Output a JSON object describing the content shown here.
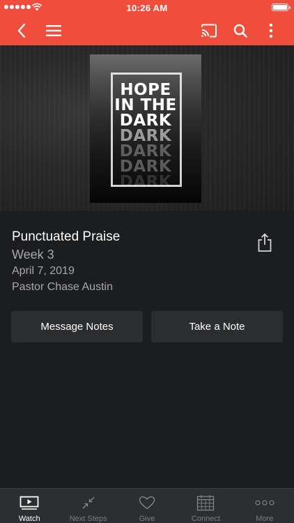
{
  "status_bar": {
    "time": "10:26 AM"
  },
  "nav": {
    "back_icon": "chevron-left-icon",
    "menu_icon": "hamburger-icon",
    "cast_icon": "cast-icon",
    "search_icon": "search-icon",
    "more_icon": "vertical-dots-icon"
  },
  "poster": {
    "line1": "HOPE",
    "line2": "IN THE",
    "line3": "DARK",
    "echo": [
      "DARK",
      "DARK",
      "DARK",
      "DARK"
    ]
  },
  "sermon": {
    "title": "Punctuated Praise",
    "week": "Week 3",
    "date": "April 7, 2019",
    "speaker": "Pastor Chase Austin"
  },
  "actions": {
    "message_notes": "Message Notes",
    "take_note": "Take a Note"
  },
  "tabs": [
    {
      "label": "Watch",
      "icon": "play-screen-icon",
      "active": true
    },
    {
      "label": "Next Steps",
      "icon": "arrows-in-icon",
      "active": false
    },
    {
      "label": "Give",
      "icon": "heart-icon",
      "active": false
    },
    {
      "label": "Connect",
      "icon": "calendar-icon",
      "active": false
    },
    {
      "label": "More",
      "icon": "horizontal-dots-icon",
      "active": false
    }
  ],
  "colors": {
    "accent": "#f04d3c",
    "background": "#1c1d1f",
    "button": "#2c2d2f"
  }
}
